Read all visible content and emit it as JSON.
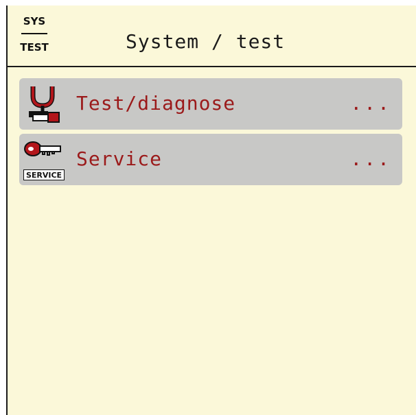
{
  "header": {
    "icon_top": "SYS",
    "icon_bottom": "TEST",
    "title": "System / test"
  },
  "menu": {
    "items": [
      {
        "label": "Test/diagnose",
        "more": "...",
        "icon": "stethoscope-icon"
      },
      {
        "label": "Service",
        "more": "...",
        "icon": "service-key-icon",
        "icon_text": "SERVICE"
      }
    ]
  },
  "colors": {
    "background": "#fbf8d9",
    "item_background": "#c8c8c6",
    "item_text": "#9b1a1a",
    "title_text": "#1b1b1b"
  }
}
